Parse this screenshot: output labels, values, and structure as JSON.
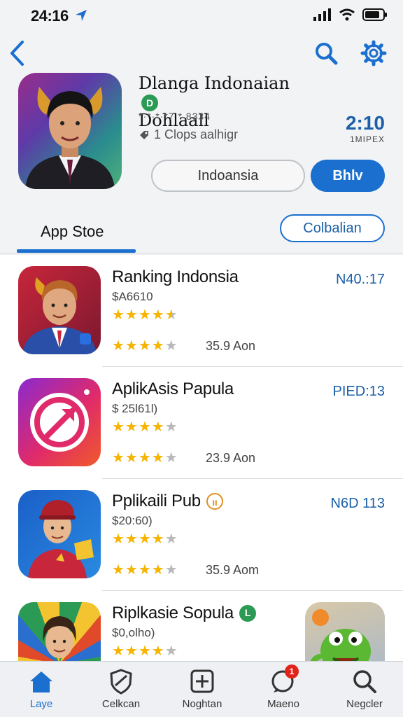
{
  "status_bar": {
    "time": "24:16"
  },
  "nav": {
    "back_icon": "chevron-left-icon",
    "search_icon": "search-icon",
    "settings_icon": "gear-icon"
  },
  "hero": {
    "title_line1": "Dlanga Indonaian",
    "title_line2": "Dohlaall",
    "title_badge": "D",
    "rating_text": "*·*·*·*7 * 8334",
    "meta_text": "1 Clops aalhigr",
    "time": "2:10",
    "sub": "1MIPEX",
    "secondary_button": "Indoansia",
    "primary_button": "Bhlv",
    "colors": {
      "accent": "#1a6fcf"
    }
  },
  "tabs": {
    "active": "App Stoe",
    "pill": "Colbalian"
  },
  "apps": [
    {
      "title": "Ranking Indonsia",
      "price": "$A6610",
      "rating": 4.5,
      "rating2": 4,
      "size": "35.9 Aon",
      "code": "N40.:17",
      "badge": ""
    },
    {
      "title": "AplikAsis Papula",
      "price": "$ 25l61l)",
      "rating": 4,
      "rating2": 4,
      "size": "23.9 Aon",
      "code": "PIED:13",
      "badge": ""
    },
    {
      "title": "Pplikaili Pub",
      "price": "$20:60)",
      "rating": 4,
      "rating2": 4,
      "size": "35.9 Aom",
      "code": "N6D 113",
      "badge": "ıı"
    },
    {
      "title": "Riplkasie Sopula",
      "price": "$0,olho)",
      "rating": 4,
      "rating2": 4,
      "size": "",
      "code": "",
      "badge": "L"
    }
  ],
  "tab_bar": [
    {
      "label": "Laye",
      "icon": "home-icon",
      "active": true
    },
    {
      "label": "Celkcan",
      "icon": "shield-icon",
      "active": false
    },
    {
      "label": "Noghtan",
      "icon": "plus-square-icon",
      "active": false
    },
    {
      "label": "Maeno",
      "icon": "chat-bubble-icon",
      "active": false,
      "badge": "1"
    },
    {
      "label": "Negcler",
      "icon": "search-icon",
      "active": false
    }
  ]
}
